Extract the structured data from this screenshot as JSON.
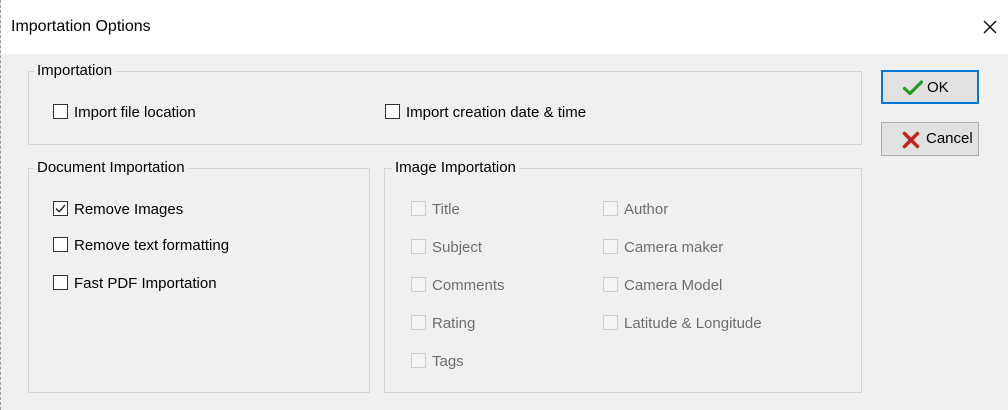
{
  "window": {
    "title": "Importation Options",
    "close_icon": "close-icon"
  },
  "importation": {
    "legend": "Importation",
    "options": [
      {
        "label": "Import file location",
        "checked": false,
        "enabled": true
      },
      {
        "label": "Import creation date & time",
        "checked": false,
        "enabled": true
      }
    ]
  },
  "document_importation": {
    "legend": "Document Importation",
    "options": [
      {
        "label": "Remove Images",
        "checked": true,
        "enabled": true
      },
      {
        "label": "Remove text formatting",
        "checked": false,
        "enabled": true
      },
      {
        "label": "Fast PDF Importation",
        "checked": false,
        "enabled": true
      }
    ]
  },
  "image_importation": {
    "legend": "Image Importation",
    "left_options": [
      {
        "label": "Title",
        "checked": false,
        "enabled": false
      },
      {
        "label": "Subject",
        "checked": false,
        "enabled": false
      },
      {
        "label": "Comments",
        "checked": false,
        "enabled": false
      },
      {
        "label": "Rating",
        "checked": false,
        "enabled": false
      },
      {
        "label": "Tags",
        "checked": false,
        "enabled": false
      }
    ],
    "right_options": [
      {
        "label": "Author",
        "checked": false,
        "enabled": false
      },
      {
        "label": "Camera maker",
        "checked": false,
        "enabled": false
      },
      {
        "label": "Camera Model",
        "checked": false,
        "enabled": false
      },
      {
        "label": "Latitude & Longitude",
        "checked": false,
        "enabled": false
      }
    ]
  },
  "buttons": {
    "ok": {
      "label": "OK",
      "icon": "checkmark-icon",
      "color": "#1e9e1e"
    },
    "cancel": {
      "label": "Cancel",
      "icon": "x-mark-icon",
      "color": "#c0281e"
    }
  },
  "colors": {
    "dialog_bg": "#f0f0f0",
    "default_button_border": "#0078d7"
  }
}
